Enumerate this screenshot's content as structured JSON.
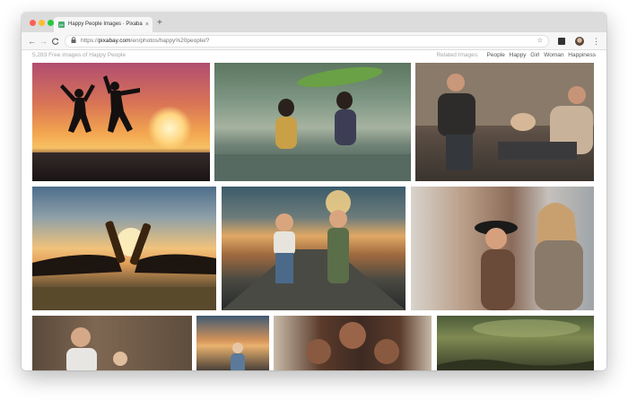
{
  "browser": {
    "tab_title": "Happy People Images · Pixaba",
    "tab_close": "×",
    "new_tab": "+",
    "favicon_text": "px",
    "nav": {
      "back": "←",
      "forward": "→",
      "reload": "C"
    },
    "url": {
      "scheme": "https://",
      "domain": "pixabay.com",
      "path": "/en/photos/happy%20people/?"
    },
    "icons": {
      "lock": "lock-icon",
      "star": "star-icon",
      "menu": "⋮"
    }
  },
  "page": {
    "results_count": "5,283 Free images of Happy People",
    "related_label": "Related Images:",
    "related": [
      "People",
      "Happy",
      "Girl",
      "Woman",
      "Happiness"
    ]
  },
  "colors": {
    "traffic_red": "#fc5f57",
    "traffic_yellow": "#fdbc2e",
    "traffic_green": "#28c840",
    "favicon": "#4aa96c"
  }
}
